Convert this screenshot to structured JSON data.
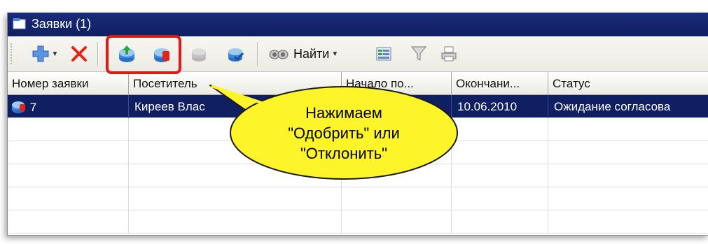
{
  "window": {
    "title": "Заявки (1)"
  },
  "toolbar": {
    "find_label": "Найти",
    "icons": [
      "add-icon",
      "dropdown-caret-icon",
      "delete-icon",
      "approve-icon",
      "reject-icon",
      "disabled-icon",
      "confirm-icon",
      "binoculars-icon",
      "filter-list-icon",
      "funnel-icon",
      "print-icon"
    ]
  },
  "table": {
    "columns": [
      "Номер заявки",
      "Посетитель",
      "Начало по...",
      "Окончани...",
      "Статус"
    ],
    "rows": [
      {
        "number": "7",
        "visitor": "Киреев Влас",
        "start": "",
        "end": "10.06.2010",
        "status": "Ожидание согласова"
      }
    ]
  },
  "callout": {
    "lines": [
      "Нажимаем",
      "\"Одобрить\" или",
      "\"Отклонить\""
    ]
  },
  "colors": {
    "titlebar": "#0f1f62",
    "selection": "#0f1f62",
    "highlight": "#e01818",
    "callout_fill": "#fdf52a"
  }
}
